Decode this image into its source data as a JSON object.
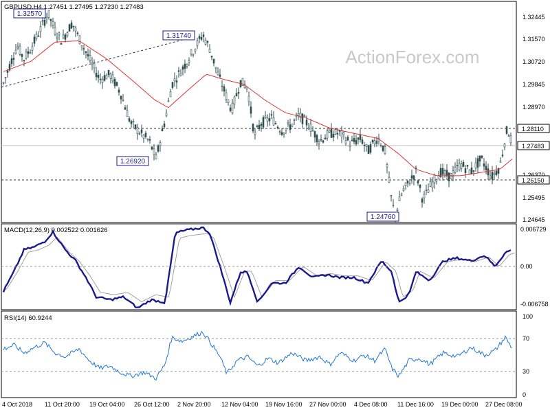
{
  "header": {
    "symbol_line": "GBPUSD,H4  1.27451 1.27495 1.27230 1.27483"
  },
  "watermark": "ActionForex.com",
  "colors": {
    "candle": "#2f4f4f",
    "sma": "#dd3333",
    "macd_main": "#1a1a8c",
    "macd_signal": "#a0a0a0",
    "rsi": "#1f77d4",
    "label_border": "#1a1a8c",
    "dashed": "#333333"
  },
  "price_axis": {
    "ticks": [
      "1.32445",
      "1.31570",
      "1.30720",
      "1.29845",
      "1.28970",
      "1.28110",
      "1.27483",
      "1.26370",
      "1.26150",
      "1.25495",
      "1.24645"
    ]
  },
  "x_axis": {
    "labels": [
      "4 Oct 2018",
      "11 Oct 20:00",
      "19 Oct 04:00",
      "26 Oct 12:00",
      "2 Nov 20:00",
      "12 Nov 04:00",
      "19 Nov 16:00",
      "27 Nov 00:00",
      "4 Dec 08:00",
      "11 Dec 16:00",
      "19 Dec 00:00",
      "27 Dec 08:00"
    ]
  },
  "annotations": [
    "1.32570",
    "1.31740",
    "1.26920",
    "1.24760"
  ],
  "levels": {
    "resistance": "1.28110",
    "current": "1.27483",
    "support": "1.26150"
  },
  "macd": {
    "title": "MACD(12,26,9) 0.002522 0.001626",
    "ticks": [
      "0.006729",
      "0.00",
      "-0.006758"
    ]
  },
  "rsi": {
    "title": "RSI(14) 60.9244",
    "ticks": [
      "100",
      "70",
      "30",
      "0"
    ]
  },
  "chart_data": {
    "type": "candlestick",
    "title": "GBPUSD,H4",
    "y_range": [
      1.24645,
      1.32445
    ],
    "price_path": [
      [
        0,
        1.2985
      ],
      [
        10,
        1.306
      ],
      [
        20,
        1.313
      ],
      [
        30,
        1.308
      ],
      [
        40,
        1.312
      ],
      [
        55,
        1.32
      ],
      [
        65,
        1.3257
      ],
      [
        75,
        1.319
      ],
      [
        85,
        1.315
      ],
      [
        100,
        1.322
      ],
      [
        110,
        1.316
      ],
      [
        125,
        1.308
      ],
      [
        140,
        1.3
      ],
      [
        155,
        1.302
      ],
      [
        170,
        1.295
      ],
      [
        185,
        1.283
      ],
      [
        200,
        1.279
      ],
      [
        212,
        1.276
      ],
      [
        222,
        1.2692
      ],
      [
        235,
        1.284
      ],
      [
        245,
        1.298
      ],
      [
        255,
        1.302
      ],
      [
        265,
        1.306
      ],
      [
        278,
        1.312
      ],
      [
        290,
        1.3174
      ],
      [
        300,
        1.312
      ],
      [
        312,
        1.302
      ],
      [
        322,
        1.295
      ],
      [
        332,
        1.288
      ],
      [
        345,
        1.299
      ],
      [
        355,
        1.297
      ],
      [
        365,
        1.278
      ],
      [
        375,
        1.283
      ],
      [
        390,
        1.285
      ],
      [
        405,
        1.28
      ],
      [
        418,
        1.282
      ],
      [
        430,
        1.286
      ],
      [
        445,
        1.282
      ],
      [
        460,
        1.276
      ],
      [
        475,
        1.279
      ],
      [
        490,
        1.279
      ],
      [
        505,
        1.275
      ],
      [
        520,
        1.277
      ],
      [
        530,
        1.272
      ],
      [
        545,
        1.2775
      ],
      [
        555,
        1.272
      ],
      [
        565,
        1.252
      ],
      [
        570,
        1.2476
      ],
      [
        580,
        1.256
      ],
      [
        590,
        1.26
      ],
      [
        600,
        1.264
      ],
      [
        610,
        1.253
      ],
      [
        622,
        1.259
      ],
      [
        635,
        1.264
      ],
      [
        650,
        1.262
      ],
      [
        665,
        1.267
      ],
      [
        680,
        1.264
      ],
      [
        695,
        1.269
      ],
      [
        710,
        1.262
      ],
      [
        722,
        1.266
      ],
      [
        733,
        1.2811
      ],
      [
        740,
        1.2748
      ]
    ],
    "sma_path": [
      [
        0,
        1.303
      ],
      [
        40,
        1.307
      ],
      [
        75,
        1.3145
      ],
      [
        110,
        1.315
      ],
      [
        150,
        1.308
      ],
      [
        190,
        1.299
      ],
      [
        220,
        1.292
      ],
      [
        240,
        1.289
      ],
      [
        265,
        1.295
      ],
      [
        295,
        1.302
      ],
      [
        320,
        1.3
      ],
      [
        350,
        1.298
      ],
      [
        380,
        1.292
      ],
      [
        410,
        1.287
      ],
      [
        440,
        1.285
      ],
      [
        475,
        1.281
      ],
      [
        510,
        1.279
      ],
      [
        545,
        1.277
      ],
      [
        575,
        1.271
      ],
      [
        600,
        1.265
      ],
      [
        630,
        1.2625
      ],
      [
        665,
        1.2625
      ],
      [
        700,
        1.264
      ],
      [
        722,
        1.265
      ],
      [
        740,
        1.269
      ]
    ],
    "macd_path": [
      [
        0,
        -0.0045
      ],
      [
        15,
        -0.001
      ],
      [
        30,
        0.003
      ],
      [
        45,
        0.0035
      ],
      [
        60,
        0.0045
      ],
      [
        72,
        0.0062
      ],
      [
        90,
        0.003
      ],
      [
        105,
        0.001
      ],
      [
        120,
        -0.002
      ],
      [
        135,
        -0.0055
      ],
      [
        155,
        -0.006
      ],
      [
        175,
        -0.0055
      ],
      [
        195,
        -0.0075
      ],
      [
        215,
        -0.006
      ],
      [
        235,
        -0.0065
      ],
      [
        250,
        0.006
      ],
      [
        265,
        0.0065
      ],
      [
        290,
        0.007
      ],
      [
        300,
        0.006
      ],
      [
        315,
        0.0
      ],
      [
        330,
        -0.0065
      ],
      [
        345,
        -0.001
      ],
      [
        355,
        -0.001
      ],
      [
        370,
        -0.0065
      ],
      [
        390,
        -0.003
      ],
      [
        410,
        -0.003
      ],
      [
        430,
        0.0
      ],
      [
        450,
        -0.002
      ],
      [
        470,
        -0.0015
      ],
      [
        490,
        -0.002
      ],
      [
        510,
        -0.002
      ],
      [
        530,
        -0.003
      ],
      [
        550,
        0.001
      ],
      [
        565,
        -0.001
      ],
      [
        575,
        -0.0065
      ],
      [
        590,
        -0.005
      ],
      [
        600,
        -0.001
      ],
      [
        620,
        -0.0025
      ],
      [
        640,
        0.001
      ],
      [
        660,
        0.0015
      ],
      [
        680,
        0.001
      ],
      [
        700,
        0.002
      ],
      [
        715,
        0.0
      ],
      [
        730,
        0.0025
      ],
      [
        740,
        0.003
      ]
    ],
    "rsi_path": [
      [
        0,
        60
      ],
      [
        15,
        65
      ],
      [
        30,
        55
      ],
      [
        45,
        62
      ],
      [
        60,
        68
      ],
      [
        75,
        55
      ],
      [
        90,
        50
      ],
      [
        110,
        60
      ],
      [
        125,
        45
      ],
      [
        140,
        35
      ],
      [
        155,
        38
      ],
      [
        170,
        30
      ],
      [
        185,
        25
      ],
      [
        205,
        30
      ],
      [
        222,
        22
      ],
      [
        235,
        40
      ],
      [
        245,
        75
      ],
      [
        260,
        70
      ],
      [
        280,
        78
      ],
      [
        290,
        82
      ],
      [
        300,
        70
      ],
      [
        315,
        50
      ],
      [
        325,
        28
      ],
      [
        340,
        45
      ],
      [
        355,
        50
      ],
      [
        370,
        38
      ],
      [
        385,
        48
      ],
      [
        400,
        42
      ],
      [
        420,
        55
      ],
      [
        440,
        45
      ],
      [
        460,
        50
      ],
      [
        475,
        40
      ],
      [
        490,
        55
      ],
      [
        510,
        45
      ],
      [
        525,
        52
      ],
      [
        540,
        45
      ],
      [
        555,
        60
      ],
      [
        565,
        35
      ],
      [
        575,
        25
      ],
      [
        590,
        45
      ],
      [
        605,
        48
      ],
      [
        620,
        40
      ],
      [
        640,
        55
      ],
      [
        660,
        50
      ],
      [
        680,
        62
      ],
      [
        700,
        52
      ],
      [
        715,
        58
      ],
      [
        730,
        75
      ],
      [
        740,
        61
      ]
    ]
  }
}
